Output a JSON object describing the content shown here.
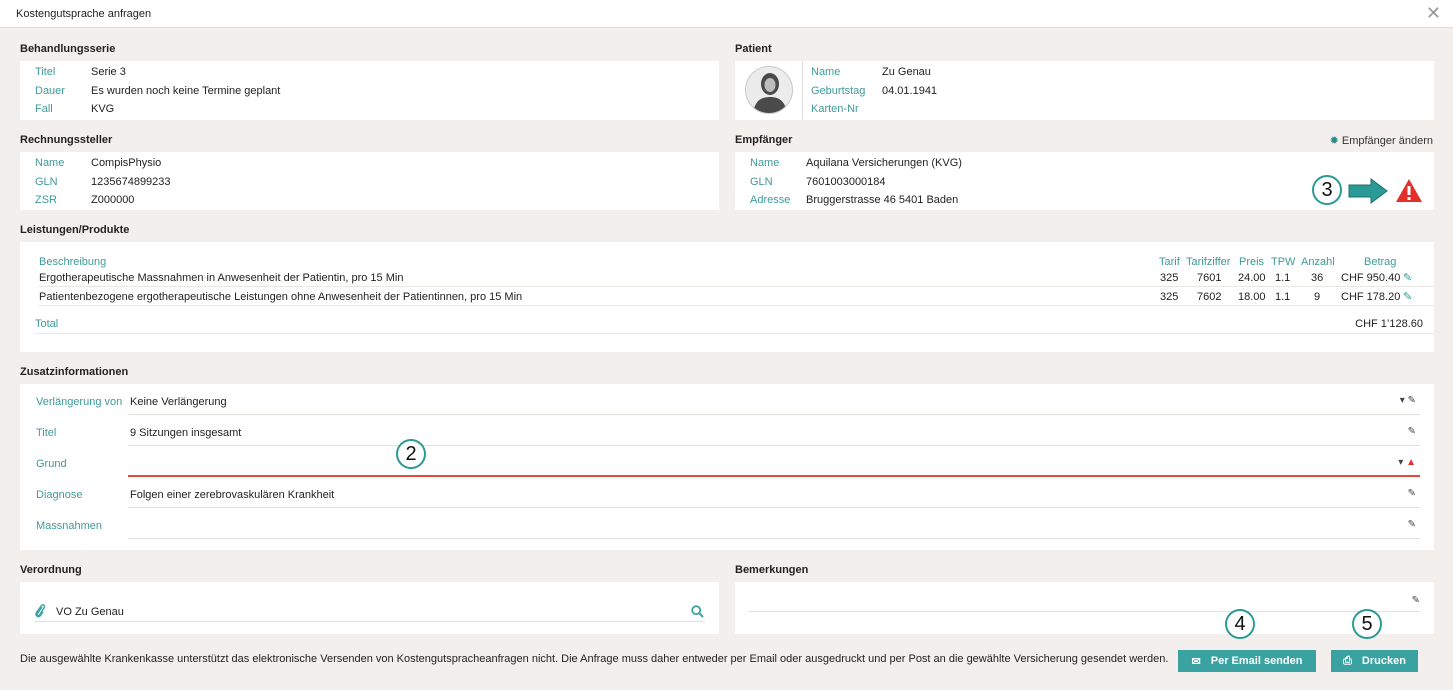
{
  "window": {
    "title": "Kostengutsprache anfragen",
    "close_label": "✕"
  },
  "behandlungsserie": {
    "heading": "Behandlungsserie",
    "rows": [
      {
        "k": "Titel",
        "v": "Serie 3"
      },
      {
        "k": "Dauer",
        "v": "Es wurden noch keine Termine geplant"
      },
      {
        "k": "Fall",
        "v": "KVG"
      }
    ]
  },
  "patient": {
    "heading": "Patient",
    "rows": [
      {
        "k": "Name",
        "v": "Zu Genau"
      },
      {
        "k": "Geburtstag",
        "v": "04.01.1941"
      },
      {
        "k": "Karten-Nr",
        "v": ""
      }
    ]
  },
  "rechnungssteller": {
    "heading": "Rechnungssteller",
    "rows": [
      {
        "k": "Name",
        "v": "CompisPhysio"
      },
      {
        "k": "GLN",
        "v": "1235674899233"
      },
      {
        "k": "ZSR",
        "v": "Z000000"
      }
    ]
  },
  "empfaenger": {
    "heading": "Empfänger",
    "change_label": "Empfänger ändern",
    "rows": [
      {
        "k": "Name",
        "v": "Aquilana Versicherungen (KVG)"
      },
      {
        "k": "GLN",
        "v": "7601003000184"
      },
      {
        "k": "Adresse",
        "v": "Bruggerstrasse 46 5401 Baden"
      }
    ]
  },
  "leistungen": {
    "heading": "Leistungen/Produkte",
    "columns": [
      "Beschreibung",
      "Tarif",
      "Tarifziffer",
      "Preis",
      "TPW",
      "Anzahl",
      "Betrag"
    ],
    "rows": [
      [
        "Ergotherapeutische Massnahmen in Anwesenheit der Patientin, pro 15 Min",
        "325",
        "7601",
        "24.00",
        "1.1",
        "36",
        "CHF 950.40"
      ],
      [
        "Patientenbezogene ergotherapeutische Leistungen ohne Anwesenheit der Patientinnen, pro 15 Min",
        "325",
        "7602",
        "18.00",
        "1.1",
        "9",
        "CHF 178.20"
      ]
    ],
    "total_label": "Total",
    "total_value": "CHF 1’128.60"
  },
  "zusatz": {
    "heading": "Zusatzinformationen",
    "rows": [
      {
        "label": "Verlängerung von",
        "value": "Keine Verlängerung"
      },
      {
        "label": "Titel",
        "value": "9 Sitzungen insgesamt"
      },
      {
        "label": "Grund",
        "value": ""
      },
      {
        "label": "Diagnose",
        "value": "Folgen einer zerebrovaskulären Krankheit"
      },
      {
        "label": "Massnahmen",
        "value": ""
      }
    ]
  },
  "verordnung": {
    "heading": "Verordnung",
    "value": "VO Zu Genau"
  },
  "bemerkungen": {
    "heading": "Bemerkungen"
  },
  "footer": {
    "notice": "Die ausgewählte Krankenkasse unterstützt das elektronische Versenden von Kostengutspracheanfragen nicht. Die Anfrage muss daher entweder per Email oder ausgedruckt und per Post an die gewählte Versicherung gesendet werden.",
    "email_button": "Per Email senden",
    "print_button": "Drucken"
  },
  "annotations": [
    "3",
    "2",
    "4",
    "5"
  ],
  "colors": {
    "accent": "#3aa3a1",
    "label": "#3f9a9a",
    "error": "#e04a3a",
    "background": "#f3efec"
  },
  "icons": [
    "close-icon",
    "avatar",
    "gear-icon",
    "arrow-right-icon",
    "warning-icon",
    "edit-pencil-icon",
    "dropdown-caret-icon",
    "paperclip-icon",
    "search-icon",
    "mail-icon",
    "printer-icon"
  ]
}
